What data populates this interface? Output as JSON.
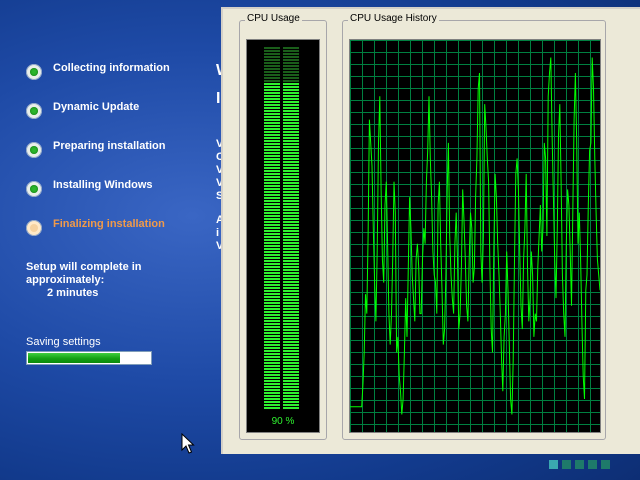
{
  "setup": {
    "steps": [
      {
        "label": "Collecting information",
        "state": "done"
      },
      {
        "label": "Dynamic Update",
        "state": "done"
      },
      {
        "label": "Preparing installation",
        "state": "done"
      },
      {
        "label": "Installing Windows",
        "state": "done"
      },
      {
        "label": "Finalizing installation",
        "state": "current"
      }
    ],
    "eta_line1": "Setup will complete in",
    "eta_line2": "approximately:",
    "eta_time": "2 minutes",
    "progress_label": "Saving settings",
    "progress_value": 0.75,
    "background_text_fragments": [
      "W",
      "I",
      "V",
      "C",
      "V",
      "V",
      "S",
      "A",
      "i",
      "V"
    ]
  },
  "taskmgr": {
    "cpu_usage_title": "CPU Usage",
    "cpu_history_title": "CPU Usage History",
    "cpu_percent": 90,
    "cpu_percent_text": "90 %",
    "history": [
      6,
      6,
      6,
      6,
      6,
      6,
      6,
      6,
      6,
      6,
      12,
      20,
      35,
      30,
      50,
      80,
      74,
      68,
      52,
      38,
      28,
      46,
      74,
      86,
      62,
      44,
      38,
      58,
      64,
      48,
      30,
      22,
      30,
      44,
      64,
      56,
      20,
      24,
      14,
      10,
      4,
      8,
      20,
      34,
      24,
      42,
      60,
      52,
      40,
      34,
      28,
      44,
      48,
      42,
      30,
      30,
      44,
      52,
      48,
      64,
      72,
      86,
      70,
      60,
      46,
      40,
      38,
      30,
      58,
      64,
      48,
      36,
      22,
      26,
      40,
      62,
      74,
      50,
      40,
      34,
      30,
      48,
      56,
      44,
      26,
      30,
      42,
      62,
      54,
      44,
      32,
      28,
      44,
      56,
      52,
      38,
      42,
      60,
      70,
      88,
      92,
      46,
      38,
      50,
      84,
      78,
      70,
      64,
      42,
      26,
      20,
      46,
      66,
      60,
      48,
      40,
      30,
      18,
      10,
      24,
      30,
      46,
      36,
      22,
      8,
      4,
      18,
      44,
      66,
      70,
      62,
      46,
      32,
      26,
      44,
      52,
      66,
      42,
      28,
      34,
      46,
      40,
      24,
      30,
      28,
      42,
      50,
      58,
      46,
      52,
      74,
      70,
      50,
      86,
      92,
      96,
      76,
      60,
      44,
      34,
      52,
      76,
      84,
      64,
      40,
      30,
      24,
      48,
      62,
      58,
      46,
      32,
      56,
      80,
      92,
      74,
      48,
      56,
      44,
      28,
      14,
      8,
      36,
      40,
      58,
      72,
      74,
      96,
      88,
      70,
      56,
      44,
      40,
      36
    ]
  },
  "colors": {
    "graph_line": "#00ff00",
    "graph_grid": "#008040",
    "meter_on": "#2ff22f",
    "meter_off": "#1a5e1a"
  },
  "icons": {
    "cursor": "arrow-cursor-icon"
  }
}
